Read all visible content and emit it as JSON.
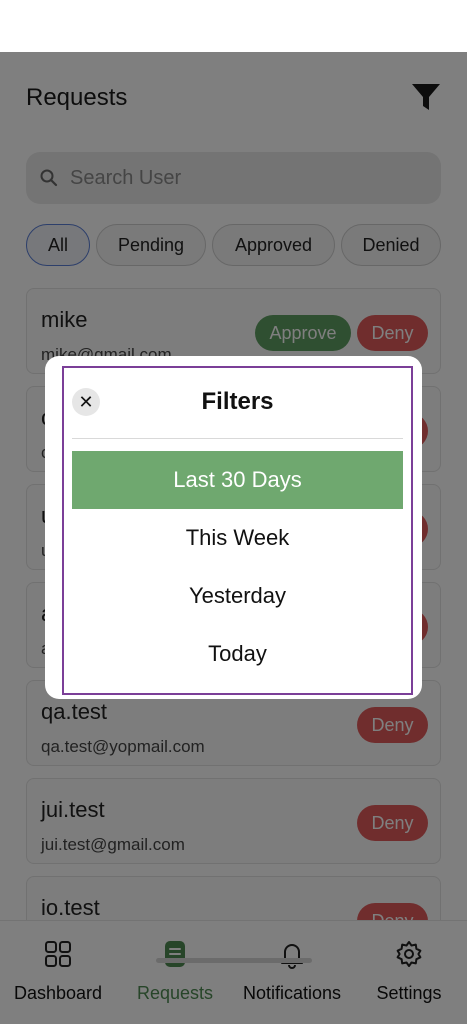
{
  "header": {
    "title": "Requests"
  },
  "search": {
    "placeholder": "Search User"
  },
  "chips": [
    "All",
    "Pending",
    "Approved",
    "Denied"
  ],
  "requests": [
    {
      "name": "mike",
      "email": "mike@gmail.com",
      "approve_label": "Approve",
      "deny_label": "Deny"
    },
    {
      "name": "c",
      "email": "c",
      "approve_label": "",
      "deny_label": ""
    },
    {
      "name": "u",
      "email": "u",
      "approve_label": "",
      "deny_label": ""
    },
    {
      "name": "a",
      "email": "a",
      "approve_label": "",
      "deny_label": ""
    },
    {
      "name": "qa.test",
      "email": "qa.test@yopmail.com",
      "deny_label": "Deny"
    },
    {
      "name": "jui.test",
      "email": "jui.test@gmail.com",
      "deny_label": "Deny"
    },
    {
      "name": "io.test",
      "email": "",
      "deny_label": "Deny"
    }
  ],
  "nav": [
    {
      "label": "Dashboard",
      "icon": "dashboard-icon"
    },
    {
      "label": "Requests",
      "icon": "requests-icon"
    },
    {
      "label": "Notifications",
      "icon": "bell-icon"
    },
    {
      "label": "Settings",
      "icon": "gear-icon"
    }
  ],
  "modal": {
    "title": "Filters",
    "close_glyph": "✕",
    "options": [
      "Last 30 Days",
      "This Week",
      "Yesterday",
      "Today"
    ]
  },
  "colors": {
    "approve": "#5e9e62",
    "deny": "#e15b5b",
    "selected_option": "#6fa86f",
    "modal_border": "#7b3f98",
    "active_nav": "#4e8b52"
  }
}
